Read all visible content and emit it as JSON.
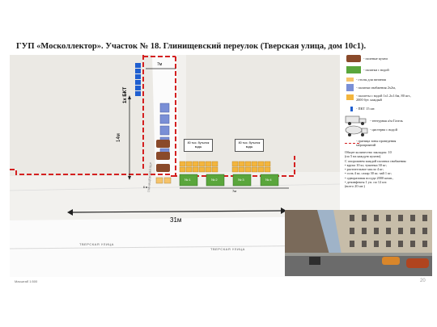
{
  "title": "ГУП «Москоллектор». Участок № 18. Глинищевский переулок (Тверская улица, дом 10с1).",
  "page_number": "20",
  "scale_label": "Масштаб 1:500",
  "map": {
    "street_tverskaya_1": "ТВЕРСКАЯ УЛИЦА",
    "street_tverskaya_2": "ТВЕРСКАЯ УЛИЦА",
    "street_glinishchevsky": "ГЛИНИЩЕВСКИЙ ПЕР",
    "booth_rotated": "1х БКТ",
    "dim_7m": "7м",
    "dim_14m": "14м",
    "dim_31m": "31м",
    "dim_6m": "6 м",
    "dim_7m_b": "7м",
    "note_1": "80 тыс. бутылок воды",
    "note_2": "80 тыс. бутылок воды",
    "tents": [
      "№ 1",
      "№ 2",
      "№ 3",
      "№ 4"
    ]
  },
  "legend": {
    "items": [
      {
        "icon": "field-kitchen",
        "label": "- полевые кухни"
      },
      {
        "icon": "water-tent",
        "label": "- палатки с водой"
      },
      {
        "icon": "food-table",
        "label": "- столы для питания"
      },
      {
        "icon": "supply-tent",
        "label": "- палатки снабжения 2х2м,"
      },
      {
        "icon": "pallet",
        "label": "- паллеты с водой 1х1.2х1.6м, 80 шт., 2000 бут. каждый"
      },
      {
        "icon": "toilet-booth",
        "label": "- ПКТ 15 шт."
      },
      {
        "icon": "truck",
        "label": "- тентурная а/м Газель"
      },
      {
        "icon": "tanker",
        "label": "- цистерна с водой"
      },
      {
        "icon": "zone-border",
        "label": "- граница зоны проведения мероприятий"
      }
    ],
    "notes": [
      "Общее количество закладок: 10",
      "(по 5 на каждую кухню).",
      "С опорожнем каждой палатки снабжения:",
      "• крупа 10 кг, тушенка 30 кг;",
      "• растительное масло 4 кг;",
      "• соль 4 кг, сахар 30 кг, чай 1 кг;",
      "• одноразовая посуда 2000 комп.,",
      "• дезинфекты 1 уп. по 12 шт.",
      "(всего 20 шт.)"
    ]
  },
  "colors": {
    "zone_border": "#d42020",
    "green_tent": "#5aa63c",
    "supply_tent": "#7a8fd6",
    "pallet": "#f3b53e",
    "table": "#f6c36a",
    "booth": "#1f5fd0"
  }
}
